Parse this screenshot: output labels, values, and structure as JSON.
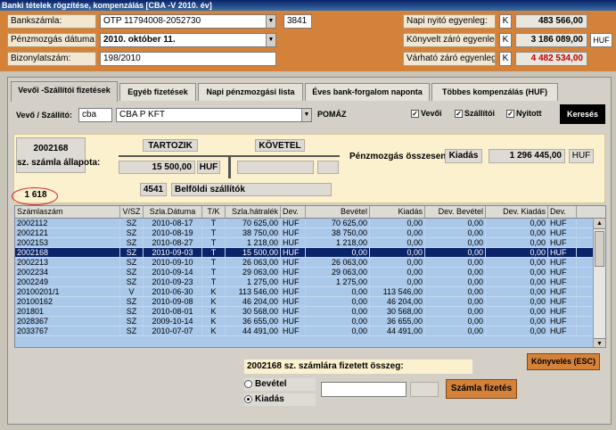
{
  "window_title": "Banki tételek rögzítése, kompenzálás  [CBA -V  2010. év]",
  "header": {
    "bankszamla_label": "Bankszámla:",
    "bankszamla_value": "OTP 11794008-2052730",
    "bank_code": "3841",
    "datum_label": "Pénzmozgás dátuma:",
    "datum_value": "2010.   október   11.",
    "bizonylat_label": "Bizonylatszám:",
    "bizonylat_value": "198/2010",
    "nyito_label": "Napi nyitó egyenleg:",
    "nyito_k": "K",
    "nyito_value": "483 566,00",
    "konyvelt_label": "Könyvelt záró egyenleg:",
    "konyvelt_k": "K",
    "konyvelt_value": "3 186 089,00",
    "currency": "HUF",
    "varhato_label": "Várható záró egyenleg:",
    "varhato_k": "K",
    "varhato_value": "4 482 534,00",
    "varhato_color": "#c00000"
  },
  "tabs": [
    {
      "label": "Vevői -Szállítói fizetések"
    },
    {
      "label": "Egyéb fizetések"
    },
    {
      "label": "Napi pénzmozgási lista"
    },
    {
      "label": "Éves bank-forgalom naponta"
    },
    {
      "label": "Többes kompenzálás (HUF)"
    }
  ],
  "filter": {
    "label": "Vevő / Szállító:",
    "code": "cba",
    "partner": "CBA P KFT",
    "city": "POMÁZ",
    "chk_vevoi": "Vevői",
    "chk_szallitoi": "Szállítói",
    "chk_nyitott": "Nyitott",
    "search_button": "Keresés"
  },
  "status": {
    "invoice_no": "2002168",
    "invoice_status_label": "sz. számla állapota:",
    "tartozik_label": "TARTOZIK",
    "kovetel_label": "KÖVETEL",
    "tartozik_value": "15 500,00",
    "currency": "HUF",
    "account_no": "4541",
    "account_name": "Belföldi szállítók",
    "count": "1 618",
    "penzmozgas_label": "Pénzmozgás összesen:",
    "kiadas_label": "Kiadás",
    "total_value": "1 296 445,00",
    "total_currency": "HUF"
  },
  "table": {
    "headers": [
      "Számlaszám",
      "V/SZ",
      "Szla.Dátuma",
      "T/K",
      "Szla.hátralék",
      "Dev.",
      "Bevétel",
      "Kiadás",
      "Dev. Bevétel",
      "Dev. Kiadás",
      "Dev."
    ],
    "rows": [
      [
        "2002112",
        "SZ",
        "2010-08-17",
        "T",
        "70 625,00",
        "HUF",
        "70 625,00",
        "0,00",
        "0,00",
        "0,00",
        "HUF"
      ],
      [
        "2002121",
        "SZ",
        "2010-08-19",
        "T",
        "38 750,00",
        "HUF",
        "38 750,00",
        "0,00",
        "0,00",
        "0,00",
        "HUF"
      ],
      [
        "2002153",
        "SZ",
        "2010-08-27",
        "T",
        "1 218,00",
        "HUF",
        "1 218,00",
        "0,00",
        "0,00",
        "0,00",
        "HUF"
      ],
      [
        "2002168",
        "SZ",
        "2010-09-03",
        "T",
        "15 500,00",
        "HUF",
        "0,00",
        "0,00",
        "0,00",
        "0,00",
        "HUF"
      ],
      [
        "2002213",
        "SZ",
        "2010-09-10",
        "T",
        "26 063,00",
        "HUF",
        "26 063,00",
        "0,00",
        "0,00",
        "0,00",
        "HUF"
      ],
      [
        "2002234",
        "SZ",
        "2010-09-14",
        "T",
        "29 063,00",
        "HUF",
        "29 063,00",
        "0,00",
        "0,00",
        "0,00",
        "HUF"
      ],
      [
        "2002249",
        "SZ",
        "2010-09-23",
        "T",
        "1 275,00",
        "HUF",
        "1 275,00",
        "0,00",
        "0,00",
        "0,00",
        "HUF"
      ],
      [
        "20100201/1",
        "V",
        "2010-06-30",
        "K",
        "113 546,00",
        "HUF",
        "0,00",
        "113 546,00",
        "0,00",
        "0,00",
        "HUF"
      ],
      [
        "20100162",
        "SZ",
        "2010-09-08",
        "K",
        "46 204,00",
        "HUF",
        "0,00",
        "46 204,00",
        "0,00",
        "0,00",
        "HUF"
      ],
      [
        "201801",
        "SZ",
        "2010-08-01",
        "K",
        "30 568,00",
        "HUF",
        "0,00",
        "30 568,00",
        "0,00",
        "0,00",
        "HUF"
      ],
      [
        "2028367",
        "SZ",
        "2009-10-14",
        "K",
        "36 655,00",
        "HUF",
        "0,00",
        "36 655,00",
        "0,00",
        "0,00",
        "HUF"
      ],
      [
        "2033767",
        "SZ",
        "2010-07-07",
        "K",
        "44 491,00",
        "HUF",
        "0,00",
        "44 491,00",
        "0,00",
        "0,00",
        "HUF"
      ]
    ],
    "selected_index": 3
  },
  "bottom": {
    "konyveles_button": "Könyvelés (ESC)",
    "invoice_no": "2002168",
    "paid_label": "sz. számlára fizetett összeg:",
    "radio_bevetel": "Bevétel",
    "radio_kiadas": "Kiadás",
    "szamla_button": "Számla fizetés"
  }
}
